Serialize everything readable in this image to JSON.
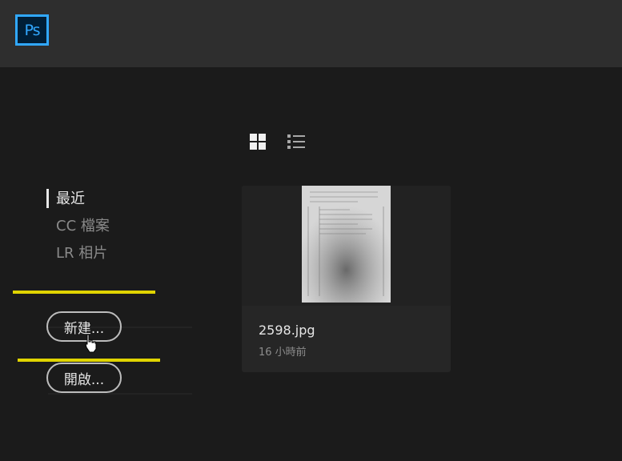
{
  "app": {
    "logo_text": "Ps",
    "brand_color": "#31a8ff",
    "highlight_color": "#e0d400"
  },
  "view_toggle": {
    "grid_icon": "grid-view-icon",
    "list_icon": "list-view-icon"
  },
  "sidebar": {
    "items": [
      {
        "label": "最近",
        "active": true
      },
      {
        "label": "CC 檔案",
        "active": false
      },
      {
        "label": "LR 相片",
        "active": false
      }
    ]
  },
  "actions": {
    "new_label": "新建...",
    "open_label": "開啟..."
  },
  "recent_files": [
    {
      "name": "2598.jpg",
      "time": "16 小時前"
    }
  ]
}
